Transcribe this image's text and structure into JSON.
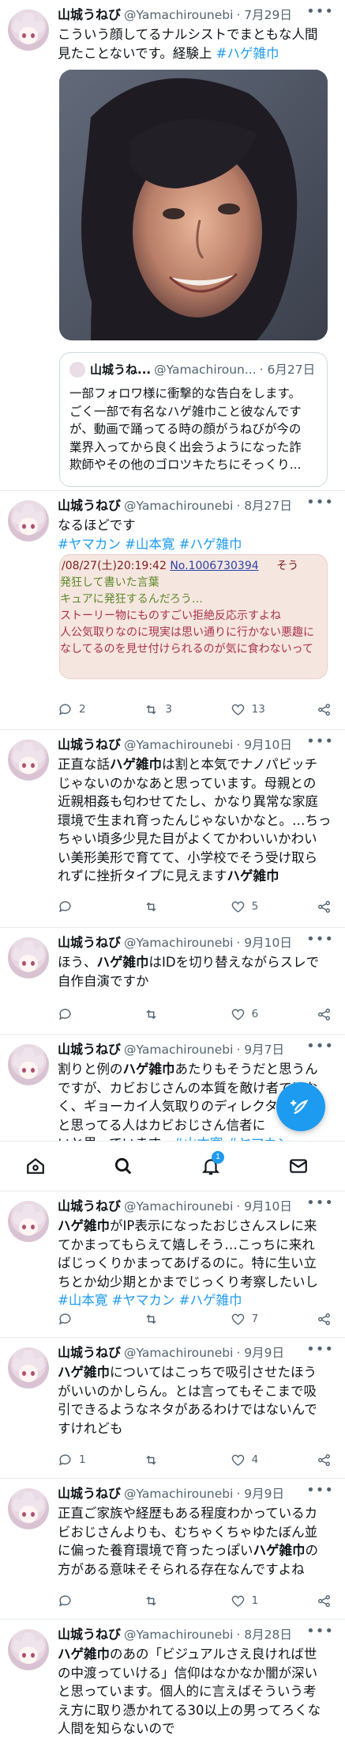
{
  "colors": {
    "accent": "#1d9bf0",
    "muted": "#536471",
    "border": "#e6ecf0"
  },
  "tweets": [
    {
      "name": "山城うねび",
      "handle": "@Yamachirounebi",
      "date": "· 7月29日",
      "text_lines": [
        "こういう顔してるナルシストでまともな人間",
        "見たことないです。経験上"
      ],
      "tag": "#ハゲ雑巾",
      "quote": {
        "name": "山城うね...",
        "handle": "@Yamachiroun...",
        "date": "· 6月27日",
        "lines": [
          "一部フォロワ様に衝撃的な告白をします。",
          "ごく一部で有名なハゲ雑巾こと彼なんです",
          "が、動画で踊ってる時の顔がうねびが今の",
          "業界入ってから良く出会うようになった詐",
          "欺師やその他のゴロツキたちにそっくり..."
        ]
      }
    },
    {
      "name": "山城うねび",
      "handle": "@Yamachirounebi",
      "date": "· 8月27日",
      "text": "なるほどです",
      "tags": [
        "#ヤマカン",
        "#山本寛",
        "#ハゲ雑巾"
      ],
      "screenshot": {
        "line1": "/08/27(土)20:19:42",
        "line1_no": "No.1006730394",
        "line1_tail": "そう",
        "green1": "発狂して書いた言葉",
        "green2": "キュアに発狂するんだろう…",
        "red1": "ストーリー物にものすごい拒絶反応示すよね",
        "red2": "人公気取りなのに現実は思い通りに行かない悪趣に",
        "red3": "なしてるのを見せ付けられるのが気に食わないって"
      },
      "replies": "2",
      "retweets": "3",
      "likes": "13"
    },
    {
      "name": "山城うねび",
      "handle": "@Yamachirounebi",
      "date": "· 9月10日",
      "lines": [
        [
          "正直な話",
          "ハゲ雑巾",
          "は割と本気でナノパビッチ"
        ],
        [
          "じゃないのかなあと思っています。母親との"
        ],
        [
          "近親相姦も匂わせてたし、かなり異常な家庭"
        ],
        [
          "環境で生まれ育ったんじゃないかなと。…ちっ"
        ],
        [
          "ちゃい頃多少見た目がよくてかわいいかわい"
        ],
        [
          "い美形美形で育てて、小学校でそう受け取ら"
        ],
        [
          "れずに挫折タイプに見えます",
          "ハゲ雑巾"
        ]
      ],
      "replies": "",
      "retweets": "",
      "likes": "5"
    },
    {
      "name": "山城うねび",
      "handle": "@Yamachirounebi",
      "date": "· 9月10日",
      "lines": [
        [
          "ほう、",
          "ハゲ雑巾",
          "はIDを切り替えながらスレで"
        ],
        [
          "自作自演ですか"
        ]
      ],
      "replies": "",
      "retweets": "",
      "likes": "6"
    },
    {
      "name": "山城うねび",
      "handle": "@Yamachirounebi",
      "date": "· 9月7日",
      "lines": [
        [
          "割りと例の",
          "ハゲ雑巾",
          "あたりもそうだと思うん"
        ],
        [
          "ですが、カビおじさんの本質を敵け者ではな"
        ],
        [
          "く、ギョーカイ人気取りのディレクタ"
        ],
        [
          "と思ってる人はカビおじさん信者に"
        ],
        [
          "いと思っています。"
        ]
      ],
      "tags": [
        "#山本寛",
        "#ヤマカン"
      ]
    },
    {
      "name": "山城うねび",
      "handle": "@Yamachirounebi",
      "date": "· 9月10日",
      "lines": [
        [
          "",
          "ハゲ雑巾",
          "がIP表示になったおじさんスレに来"
        ],
        [
          "てかまってもらえて嬉しそう…こっちに来れ"
        ],
        [
          "ばじっくりかまってあげるのに。特に生い立"
        ],
        [
          "ちとか幼少期とかまでじっくり考察したいし"
        ]
      ],
      "tags": [
        "#山本寛",
        "#ヤマカン",
        "#ハゲ雑巾"
      ],
      "replies": "",
      "retweets": "",
      "likes": "7"
    },
    {
      "name": "山城うねび",
      "handle": "@Yamachirounebi",
      "date": "· 9月9日",
      "lines": [
        [
          "",
          "ハゲ雑巾",
          "についてはこっちで吸引させたほう"
        ],
        [
          "がいいのかしらん。とは言ってもそこまで吸"
        ],
        [
          "引できるようなネタがあるわけではないんで"
        ],
        [
          "すけれども"
        ]
      ],
      "replies": "1",
      "retweets": "",
      "likes": "4"
    },
    {
      "name": "山城うねび",
      "handle": "@Yamachirounebi",
      "date": "· 9月9日",
      "lines": [
        [
          "正直ご家族や経歴もある程度わかっているカ"
        ],
        [
          "ビおじさんよりも、むちゃくちゃゆたぼん並"
        ],
        [
          "に偏った養育環境で育ったっぽい",
          "ハゲ雑巾",
          "の"
        ],
        [
          "方がある意味そそられる存在なんですよね"
        ]
      ],
      "replies": "",
      "retweets": "",
      "likes": "1"
    },
    {
      "name": "山城うねび",
      "handle": "@Yamachirounebi",
      "date": "· 8月28日",
      "lines": [
        [
          "",
          "ハゲ雑巾",
          "のあの「ビジュアルさえ良ければ世"
        ],
        [
          "の中渡っていける」信仰はなかなか闇が深い"
        ],
        [
          "と思っています。個人的に言えばそういう考"
        ],
        [
          "え方に取り憑かれてる30以上の男ってろくな"
        ],
        [
          "人間を知らないので"
        ]
      ]
    }
  ],
  "tabbar": {
    "notification_count": "1"
  }
}
